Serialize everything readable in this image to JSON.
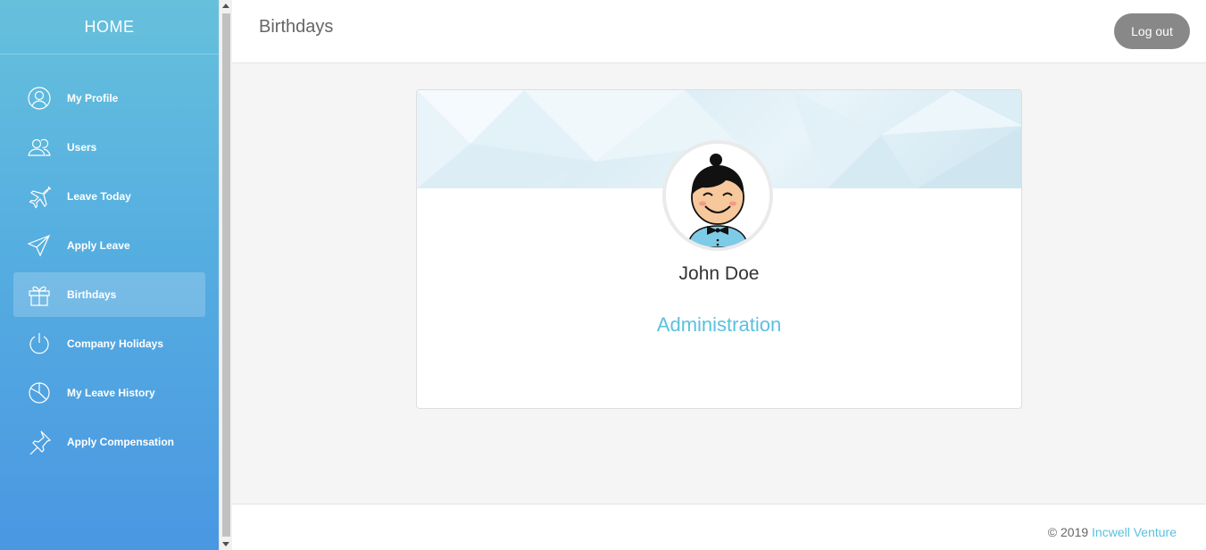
{
  "sidebar": {
    "home_label": "HOME",
    "items": [
      {
        "label": "My Profile",
        "icon": "user-circle-icon"
      },
      {
        "label": "Users",
        "icon": "users-icon"
      },
      {
        "label": "Leave Today",
        "icon": "airplane-icon"
      },
      {
        "label": "Apply Leave",
        "icon": "paper-plane-icon"
      },
      {
        "label": "Birthdays",
        "icon": "gift-icon",
        "active": true
      },
      {
        "label": "Company Holidays",
        "icon": "power-icon"
      },
      {
        "label": "My Leave History",
        "icon": "pie-chart-icon"
      },
      {
        "label": "Apply Compensation",
        "icon": "pin-icon"
      }
    ]
  },
  "header": {
    "title": "Birthdays",
    "logout_label": "Log out"
  },
  "card": {
    "name": "John Doe",
    "department": "Administration",
    "avatar_icon": "cartoon-avatar"
  },
  "footer": {
    "copyright": "© 2019",
    "company": "Incwell Venture"
  },
  "colors": {
    "accent": "#5bc0de",
    "sidebar_top": "#66c0dc",
    "sidebar_bottom": "#4a97e2",
    "logout_bg": "#888888"
  }
}
